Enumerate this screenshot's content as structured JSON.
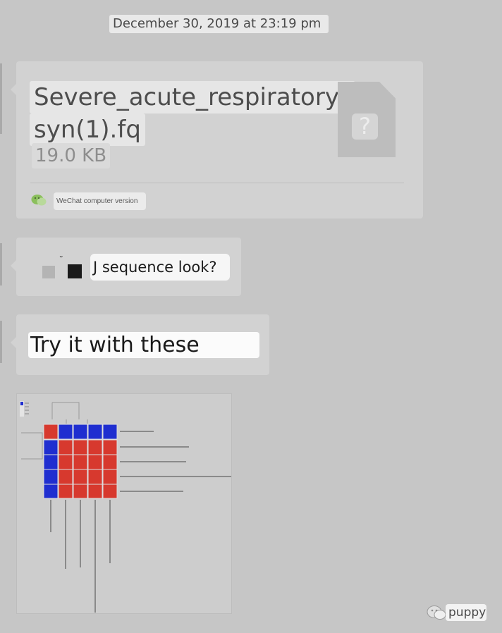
{
  "timestamp": "December 30, 2019 at 23:19 pm",
  "file_message": {
    "file_name_line1": "Severe_acute_respiratory_",
    "file_name_line2": "syn(1).fq",
    "file_size": "19.0 KB",
    "file_icon": "unknown-file-icon",
    "source_icon": "wechat-icon",
    "source_label": "WeChat computer version"
  },
  "messages": [
    {
      "text": "J sequence look?"
    },
    {
      "text": "Try it with these"
    }
  ],
  "image_message": {
    "image": "heatmap-screenshot",
    "colors": {
      "high": "#d7392e",
      "low": "#1f2ed0"
    }
  },
  "watermark": {
    "icon": "wechat-icon",
    "text": "puppy"
  }
}
